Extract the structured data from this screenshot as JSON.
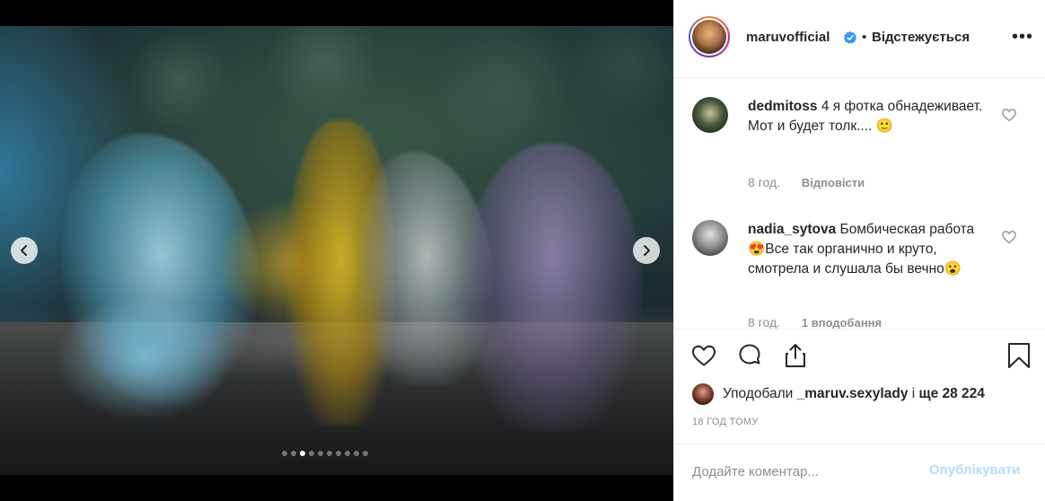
{
  "post": {
    "username": "maruvofficial",
    "separator": "•",
    "follow_status": "Відстежується",
    "more_icon": "more-horizontal-icon"
  },
  "media": {
    "slide_count": 10,
    "active_slide": 3,
    "prev_icon": "chevron-left-icon",
    "next_icon": "chevron-right-icon"
  },
  "comments": [
    {
      "username": "dedmitoss",
      "text": "4 я фотка обнадеживает. Мот и будет толк.... 🙂",
      "time": "8 год.",
      "reply_label": "Відповісти"
    },
    {
      "username": "nadia_sytova",
      "text": "Бомбическая работа😍Все так органично и круто, смотрела и слушала бы вечно😮",
      "time": "8 год.",
      "reply_label": "1 вподобання"
    }
  ],
  "likes": {
    "prefix": "Уподобали ",
    "user": "_maruv.sexylady",
    "middle": " і ",
    "count": "ще 28 224"
  },
  "timestamp": "18 ГОД ТОМУ",
  "add_comment": {
    "placeholder": "Додайте коментар...",
    "publish_label": "Опублікувати"
  },
  "colors": {
    "accent": "#0095f6",
    "publish_disabled": "#b3dbff",
    "text": "#262626",
    "muted": "#8e8e8e"
  }
}
